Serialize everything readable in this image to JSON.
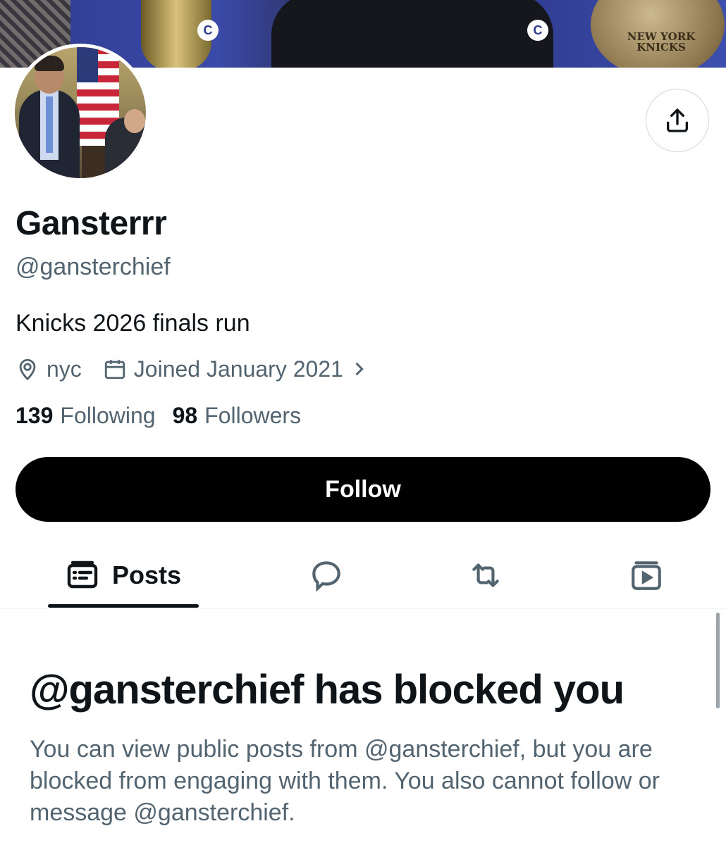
{
  "banner": {
    "ball_text": "NEW YORK KNICKS",
    "logo_letter": "C"
  },
  "profile": {
    "name": "Gansterrr",
    "handle": "@gansterchief",
    "bio": "Knicks 2026 finals run",
    "location": "nyc",
    "joined": "Joined January 2021",
    "following_count": "139",
    "following_label": "Following",
    "followers_count": "98",
    "followers_label": "Followers"
  },
  "actions": {
    "follow_label": "Follow",
    "share_icon": "share-icon"
  },
  "tabs": [
    {
      "label": "Posts",
      "icon": "posts-icon",
      "active": true
    },
    {
      "label": "",
      "icon": "replies-icon",
      "active": false
    },
    {
      "label": "",
      "icon": "reposts-icon",
      "active": false
    },
    {
      "label": "",
      "icon": "media-icon",
      "active": false
    }
  ],
  "blocked": {
    "title": "@gansterchief has blocked you",
    "message": "You can view public posts from @gansterchief, but you are blocked from engaging with them. You also cannot follow or message @gansterchief."
  },
  "colors": {
    "text_primary": "#0f1419",
    "text_secondary": "#536471",
    "follow_bg": "#000000"
  }
}
